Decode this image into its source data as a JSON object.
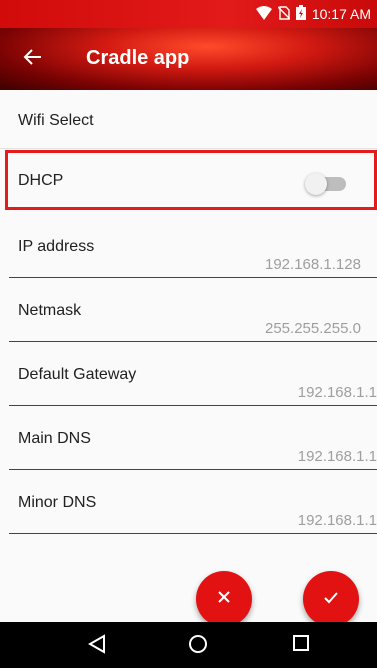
{
  "status_bar": {
    "time": "10:17 AM",
    "icons": [
      "wifi-icon",
      "no-sim-icon",
      "battery-charging-icon"
    ]
  },
  "app_bar": {
    "title": "Cradle app",
    "back_icon": "arrow-left-icon"
  },
  "settings": {
    "wifi_select": {
      "label": "Wifi Select"
    },
    "dhcp": {
      "label": "DHCP",
      "enabled": false
    },
    "ip_address": {
      "label": "IP address",
      "value": "192.168.1.128"
    },
    "netmask": {
      "label": "Netmask",
      "value": "255.255.255.0"
    },
    "default_gateway": {
      "label": "Default Gateway",
      "value": "192.168.1.1"
    },
    "main_dns": {
      "label": "Main DNS",
      "value": "192.168.1.1"
    },
    "minor_dns": {
      "label": "Minor DNS",
      "value": "192.168.1.1"
    }
  },
  "actions": {
    "cancel_icon": "close-icon",
    "confirm_icon": "check-icon"
  },
  "nav_bar": {
    "icons": [
      "nav-back-icon",
      "nav-home-icon",
      "nav-recents-icon"
    ]
  },
  "colors": {
    "accent": "#e31212",
    "highlight_border": "#e41c1c"
  }
}
